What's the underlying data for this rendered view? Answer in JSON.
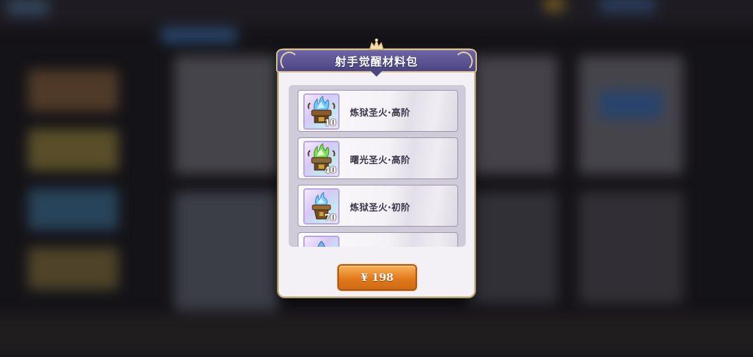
{
  "dialog": {
    "title": "射手觉醒材料包",
    "items": [
      {
        "name": "炼狱圣火·高阶",
        "count": "10",
        "icon": "blue-flame-brazier-icon"
      },
      {
        "name": "曙光圣火·高阶",
        "count": "40",
        "icon": "green-flame-brazier-icon"
      },
      {
        "name": "炼狱圣火·初阶",
        "count": "70",
        "icon": "blue-flame-brazier-icon"
      },
      {
        "name": "",
        "count": "",
        "icon": "brazier-icon"
      }
    ],
    "price_label": "¥ 198"
  },
  "colors": {
    "title_bar": "#5a5296",
    "gold_trim": "#d8c290",
    "price_button": "#e27a1c",
    "panel_bg": "#cfcbd8"
  }
}
